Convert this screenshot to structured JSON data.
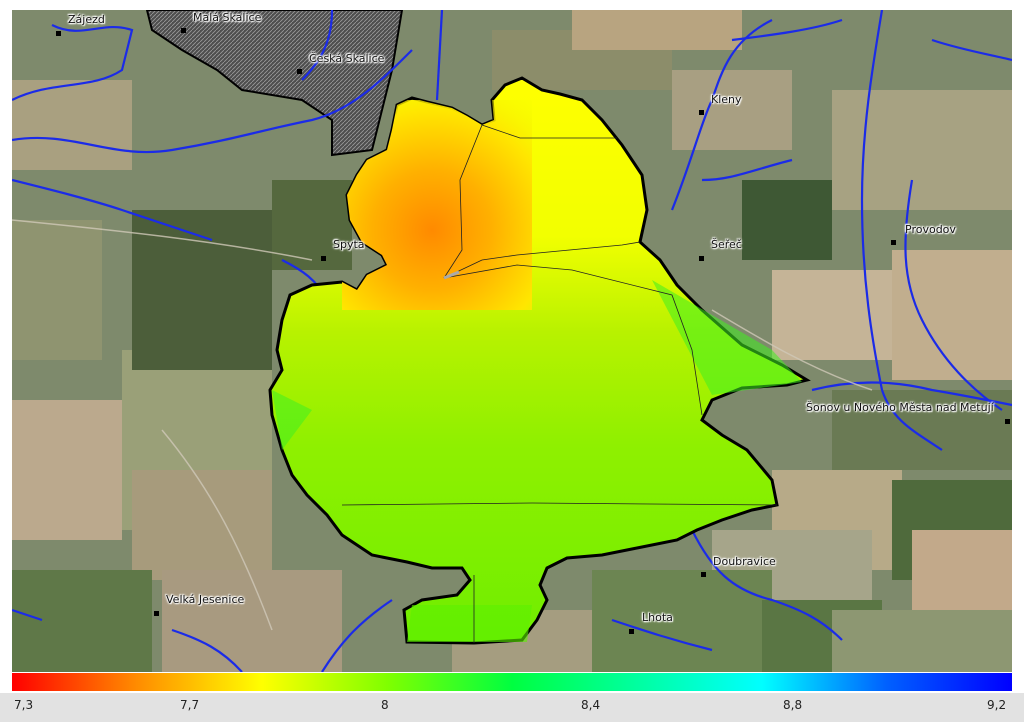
{
  "map": {
    "places": [
      {
        "id": "zajezd",
        "label": "Zájezd"
      },
      {
        "id": "mala-skalice",
        "label": "Malá Skalice"
      },
      {
        "id": "ceska-skalice",
        "label": "Česká Skalice"
      },
      {
        "id": "kleny",
        "label": "Kleny"
      },
      {
        "id": "spyta",
        "label": "Spyta"
      },
      {
        "id": "serec",
        "label": "Šeřeč"
      },
      {
        "id": "provodov",
        "label": "Provodov"
      },
      {
        "id": "sonov",
        "label": "Šonov u Nového Města nad Metují"
      },
      {
        "id": "doubravice",
        "label": "Doubravice"
      },
      {
        "id": "velka-jesenice",
        "label": "Velká Jesenice"
      },
      {
        "id": "lhota",
        "label": "Lhota"
      }
    ]
  },
  "legend": {
    "colors": [
      "#ff0000",
      "#ff8c00",
      "#ffff00",
      "#80ff00",
      "#00ff40",
      "#00ffa0",
      "#00ffff",
      "#0060ff",
      "#0000ff"
    ],
    "ticks": [
      "7,3",
      "7,7",
      "8",
      "8,4",
      "8,8",
      "9,2"
    ]
  }
}
